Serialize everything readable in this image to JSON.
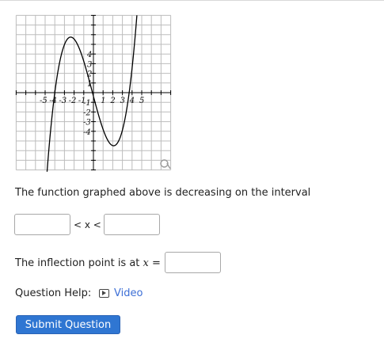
{
  "graph": {
    "x_ticks": [
      "-5",
      "-4",
      "-3",
      "-2",
      "-1",
      "1",
      "2",
      "3",
      "4",
      "5"
    ],
    "y_ticks": [
      "4",
      "3",
      "2",
      "1",
      "-1",
      "-2",
      "-3",
      "-4"
    ],
    "curve_color": "#000000",
    "zoom_icon": "magnifier-icon"
  },
  "question": {
    "prompt": "The function graphed above is decreasing on the interval",
    "interval_separator": "< x <",
    "inflection_prefix": "The inflection point is at",
    "inflection_var": "x",
    "inflection_equals": "="
  },
  "inputs": {
    "lower_bound_value": "",
    "upper_bound_value": "",
    "inflection_value": ""
  },
  "help": {
    "label": "Question Help:",
    "video_label": "Video",
    "video_icon": "video-play-icon"
  },
  "submit": {
    "label": "Submit Question",
    "color": "#2f76d2"
  }
}
